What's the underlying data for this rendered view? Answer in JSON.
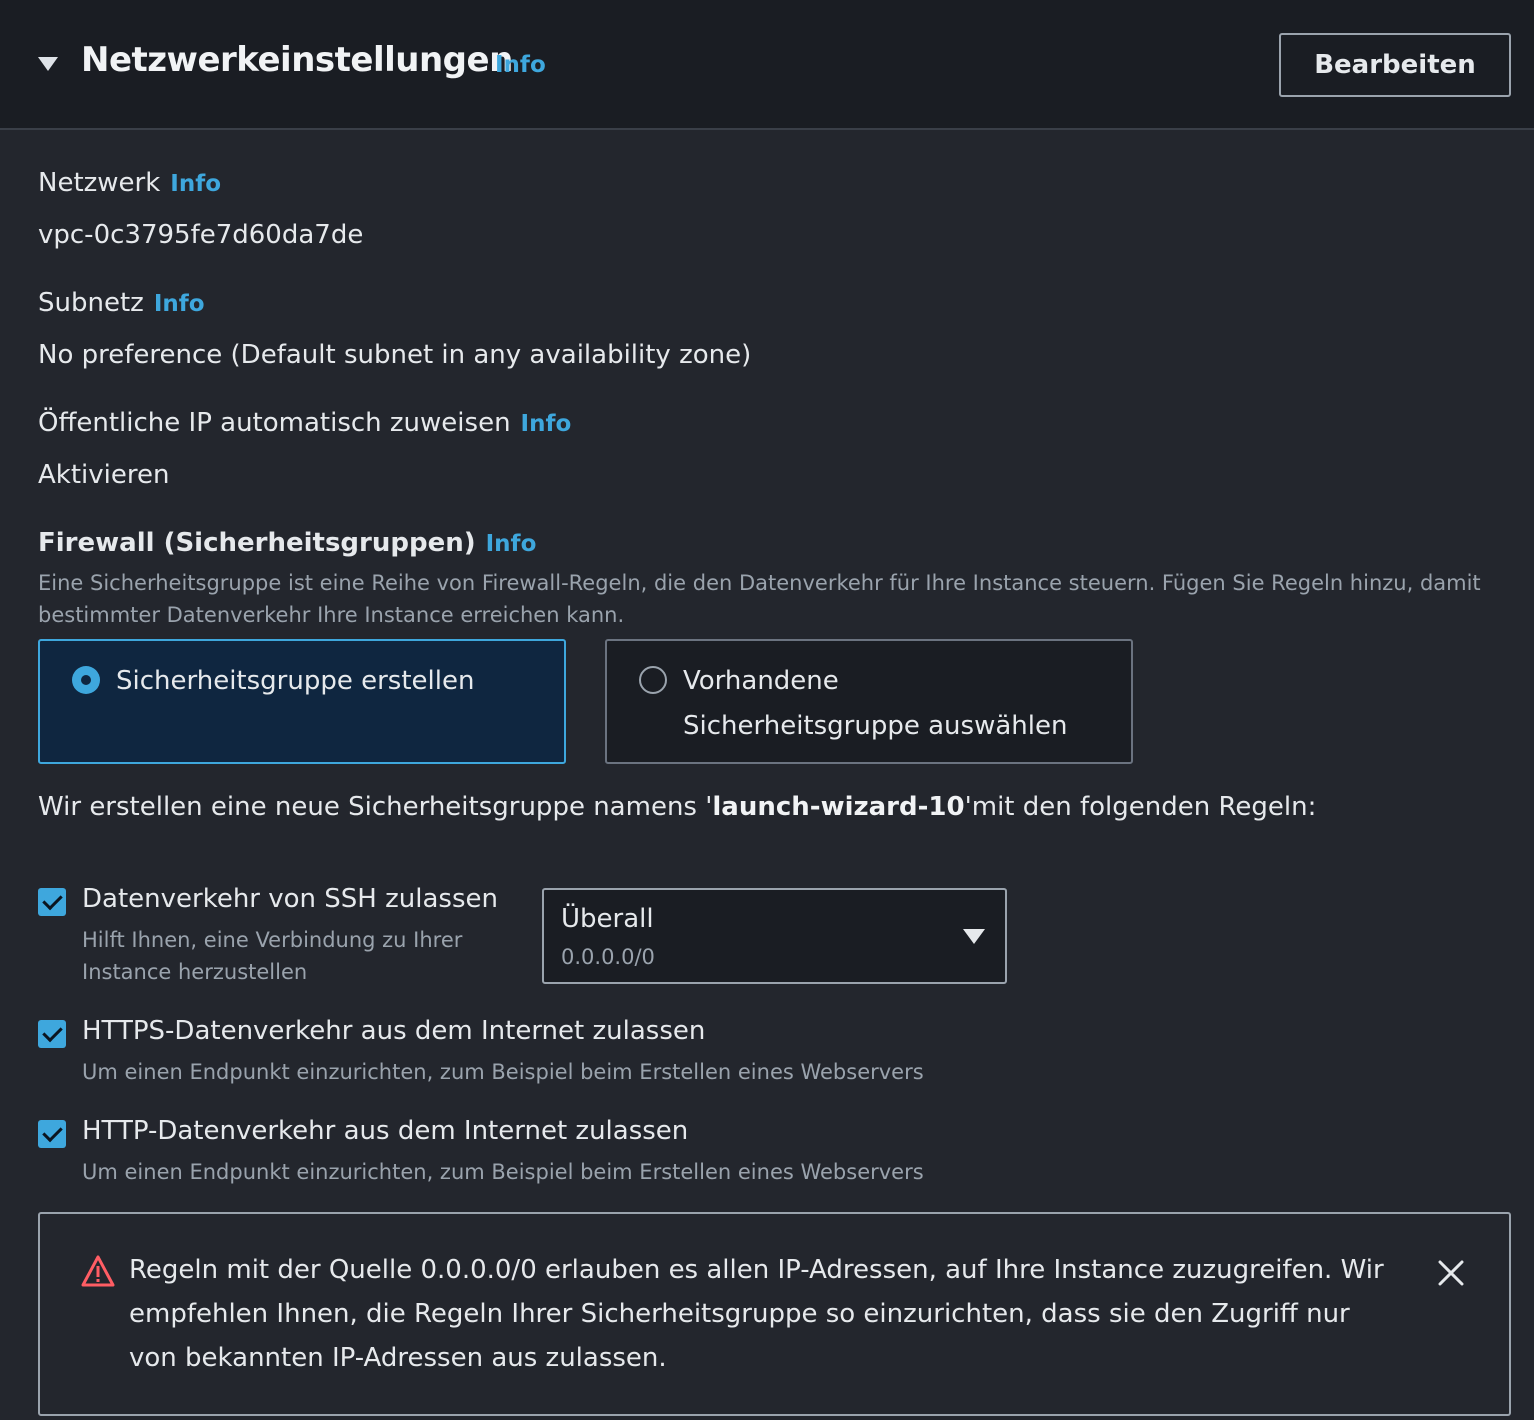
{
  "header": {
    "title": "Netzwerkeinstellungen",
    "info": "Info",
    "edit_label": "Bearbeiten"
  },
  "network": {
    "label": "Netzwerk",
    "info": "Info",
    "value": "vpc-0c3795fe7d60da7de"
  },
  "subnet": {
    "label": "Subnetz",
    "info": "Info",
    "value": "No preference (Default subnet in any availability zone)"
  },
  "public_ip": {
    "label": "Öffentliche IP automatisch zuweisen",
    "info": "Info",
    "value": "Aktivieren"
  },
  "firewall": {
    "title": "Firewall (Sicherheitsgruppen)",
    "info": "Info",
    "description": "Eine Sicherheitsgruppe ist eine Reihe von Firewall-Regeln, die den Datenverkehr für Ihre Instance steuern. Fügen Sie Regeln hinzu, damit bestimmter Datenverkehr Ihre Instance erreichen kann.",
    "options": [
      {
        "label": "Sicherheitsgruppe erstellen",
        "selected": true
      },
      {
        "label": "Vorhandene Sicherheitsgruppe auswählen",
        "selected": false
      }
    ],
    "sentence_prefix": "Wir erstellen eine neue Sicherheitsgruppe namens '",
    "group_name": "launch-wizard-10",
    "sentence_suffix": "'mit den folgenden Regeln:"
  },
  "rules": [
    {
      "label": "Datenverkehr von SSH zulassen",
      "description": "Hilft Ihnen, eine Verbindung zu Ihrer Instance herzustellen",
      "checked": true
    },
    {
      "label": "HTTPS-Datenverkehr aus dem Internet zulassen",
      "description": "Um einen Endpunkt einzurichten, zum Beispiel beim Erstellen eines Webservers",
      "checked": true
    },
    {
      "label": "HTTP-Datenverkehr aus dem Internet zulassen",
      "description": "Um einen Endpunkt einzurichten, zum Beispiel beim Erstellen eines Webservers",
      "checked": true
    }
  ],
  "ssh_source": {
    "selected": "Überall",
    "cidr": "0.0.0.0/0"
  },
  "alert": {
    "text": "Regeln mit der Quelle 0.0.0.0/0 erlauben es allen IP-Adressen, auf Ihre Instance zuzugreifen. Wir empfehlen Ihnen, die Regeln Ihrer Sicherheitsgruppe so einzurichten, dass sie den Zugriff nur von bekannten IP-Adressen aus zulassen.",
    "icon": "warning-triangle-icon"
  },
  "colors": {
    "accent": "#3ea7dd",
    "warning": "#ff5d64",
    "header_bg": "#1a1d23",
    "body_bg": "#23262d"
  }
}
